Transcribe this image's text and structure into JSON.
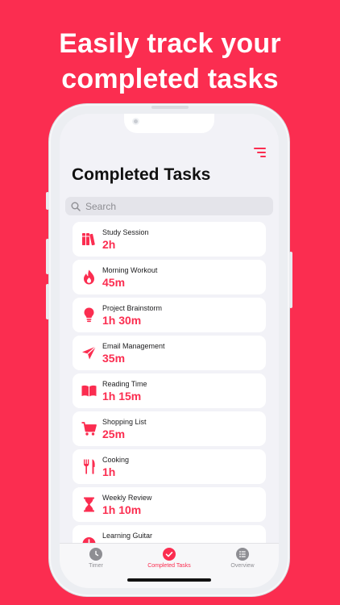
{
  "headline": {
    "line1": "Easily track your",
    "line2": "completed tasks"
  },
  "screen": {
    "title": "Completed Tasks",
    "search": {
      "placeholder": "Search"
    }
  },
  "tasks": [
    {
      "name": "Study Session",
      "duration": "2h",
      "icon": "books-icon"
    },
    {
      "name": "Morning Workout",
      "duration": "45m",
      "icon": "flame-icon"
    },
    {
      "name": "Project Brainstorm",
      "duration": "1h 30m",
      "icon": "lightbulb-icon"
    },
    {
      "name": "Email Management",
      "duration": "35m",
      "icon": "paperplane-icon"
    },
    {
      "name": "Reading Time",
      "duration": "1h 15m",
      "icon": "book-icon"
    },
    {
      "name": "Shopping List",
      "duration": "25m",
      "icon": "cart-icon"
    },
    {
      "name": "Cooking",
      "duration": "1h",
      "icon": "fork-knife-icon"
    },
    {
      "name": "Weekly Review",
      "duration": "1h 10m",
      "icon": "hourglass-icon"
    },
    {
      "name": "Learning Guitar",
      "duration": "",
      "icon": "clock-icon"
    }
  ],
  "tabs": [
    {
      "label": "Timer",
      "icon": "timer-icon",
      "active": false
    },
    {
      "label": "Completed Tasks",
      "icon": "checkmark-icon",
      "active": true
    },
    {
      "label": "Overview",
      "icon": "list-icon",
      "active": false
    }
  ],
  "colors": {
    "accent": "#FB2D50",
    "background": "#F2F2F7",
    "card": "#FFFFFF"
  }
}
